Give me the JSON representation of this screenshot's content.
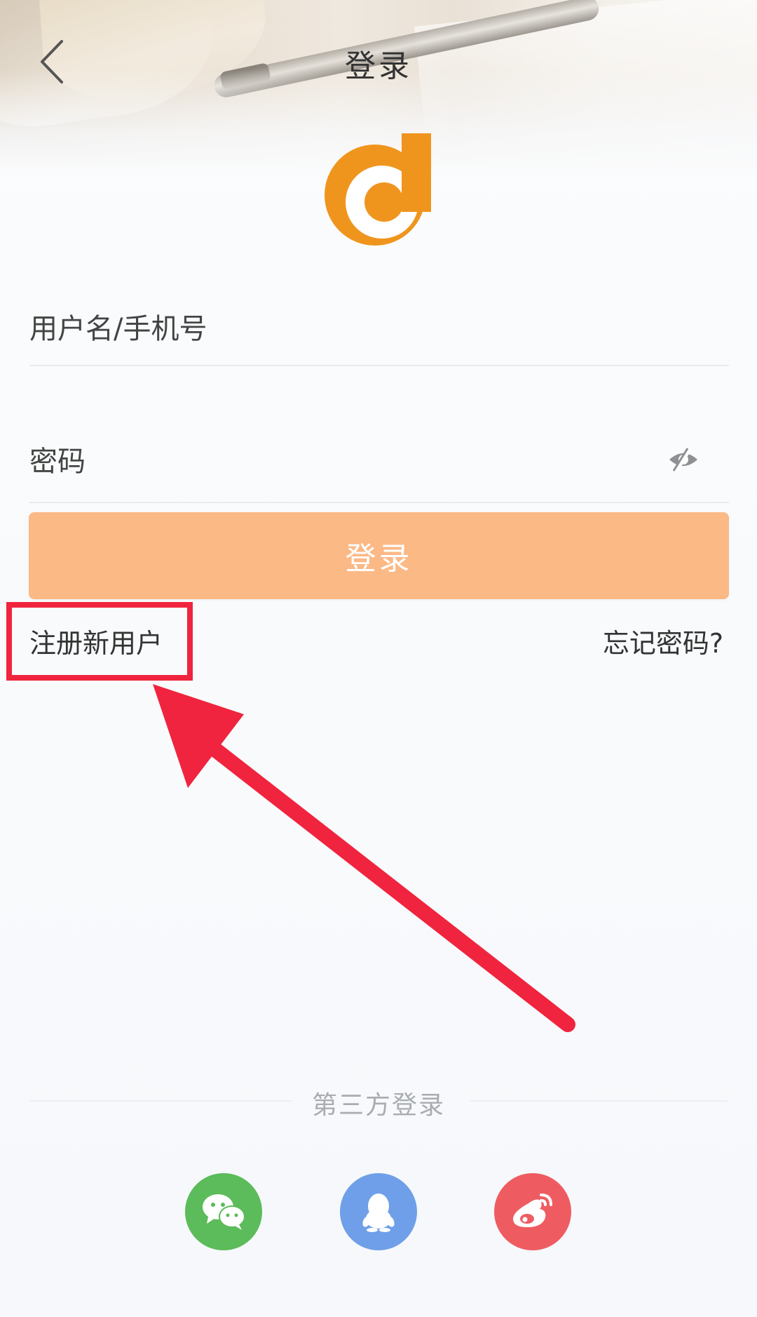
{
  "header": {
    "title": "登录",
    "back_icon": "chevron-left-icon"
  },
  "logo": {
    "icon": "brand-logo-icon",
    "color": "#ef951e"
  },
  "form": {
    "username_placeholder": "用户名/手机号",
    "password_placeholder": "密码",
    "password_toggle_icon": "eye-hidden-icon",
    "login_label": "登录",
    "login_color": "#fbb986"
  },
  "links": {
    "register": "注册新用户",
    "forgot_password": "忘记密码?"
  },
  "third_party": {
    "label": "第三方登录",
    "providers": [
      {
        "name_icon": "wechat-icon",
        "color": "#5cbb5a"
      },
      {
        "name_icon": "qq-icon",
        "color": "#6f9fe8"
      },
      {
        "name_icon": "weibo-icon",
        "color": "#ee5c62"
      }
    ]
  },
  "annotation": {
    "color": "#f0243e"
  }
}
